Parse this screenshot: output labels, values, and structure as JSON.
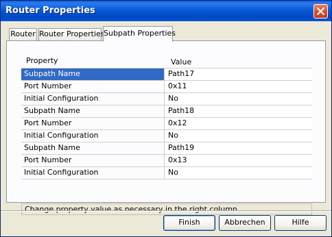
{
  "window": {
    "title": "Router Properties"
  },
  "tabs": [
    {
      "label": "Router",
      "active": false
    },
    {
      "label": "Router Properties",
      "active": false
    },
    {
      "label": "Subpath Properties",
      "active": true
    }
  ],
  "grid": {
    "columns": {
      "property": "Property",
      "value": "Value"
    },
    "rows": [
      {
        "property": "Subpath Name",
        "value": "Path17",
        "selected": true
      },
      {
        "property": "Port Number",
        "value": "0x11"
      },
      {
        "property": "Initial Configuration",
        "value": "No"
      },
      {
        "property": "Subpath Name",
        "value": "Path18"
      },
      {
        "property": "Port Number",
        "value": "0x12"
      },
      {
        "property": "Initial Configuration",
        "value": "No"
      },
      {
        "property": "Subpath Name",
        "value": "Path19"
      },
      {
        "property": "Port Number",
        "value": "0x13"
      },
      {
        "property": "Initial Configuration",
        "value": "No"
      }
    ]
  },
  "hint": "Change property value as necessary in the right column.",
  "buttons": {
    "finish": "Finish",
    "cancel": "Abbrechen",
    "help": "Hilfe"
  },
  "colors": {
    "titlebar": "#0a59d6",
    "selection": "#316ac5",
    "dialog_bg": "#ece9d8"
  },
  "icons": {
    "close": "close-icon"
  }
}
